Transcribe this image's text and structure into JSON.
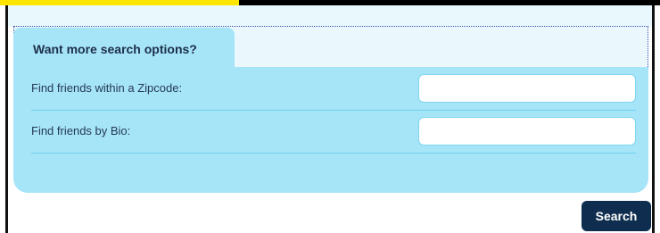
{
  "search_options": {
    "tab_title": "Want more search options?",
    "fields": [
      {
        "label": "Find friends within a Zipcode:",
        "value": "",
        "placeholder": ""
      },
      {
        "label": "Find friends by Bio:",
        "value": "",
        "placeholder": ""
      }
    ],
    "search_button_label": "Search"
  },
  "colors": {
    "highlight": "#ffe600",
    "panel": "#a6e4f7",
    "header_band": "#e8f8fc",
    "button": "#0f2e4f",
    "text": "#1d2f4a"
  }
}
